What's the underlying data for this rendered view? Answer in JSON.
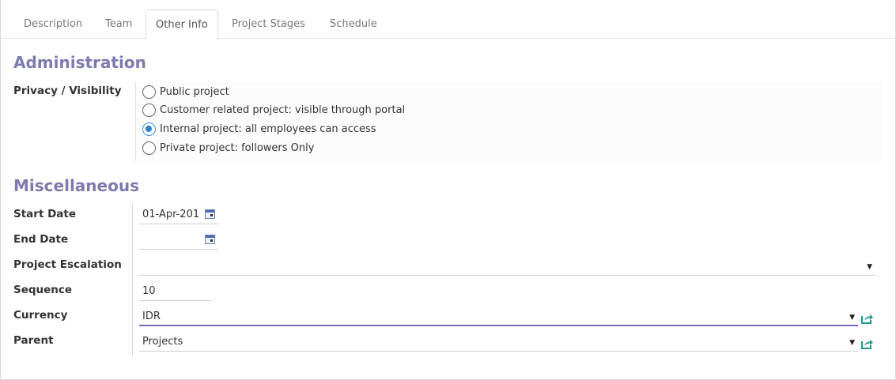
{
  "tabs": [
    {
      "label": "Description",
      "active": false
    },
    {
      "label": "Team",
      "active": false
    },
    {
      "label": "Other Info",
      "active": true
    },
    {
      "label": "Project Stages",
      "active": false
    },
    {
      "label": "Schedule",
      "active": false
    }
  ],
  "administration": {
    "title": "Administration",
    "privacy_label": "Privacy / Visibility",
    "options": [
      {
        "label": "Public project",
        "checked": false
      },
      {
        "label": "Customer related project: visible through portal",
        "checked": false
      },
      {
        "label": "Internal project: all employees can access",
        "checked": true
      },
      {
        "label": "Private project: followers Only",
        "checked": false
      }
    ]
  },
  "misc": {
    "title": "Miscellaneous",
    "start_date": {
      "label": "Start Date",
      "value": "01-Apr-201"
    },
    "end_date": {
      "label": "End Date",
      "value": ""
    },
    "escalation": {
      "label": "Project Escalation",
      "value": ""
    },
    "sequence": {
      "label": "Sequence",
      "value": "10"
    },
    "currency": {
      "label": "Currency",
      "value": "IDR"
    },
    "parent": {
      "label": "Parent",
      "value": "Projects"
    }
  },
  "colors": {
    "section_title": "#7c7bad",
    "radio_checked": "#2a7fd4",
    "focus_underline": "#7c65c4",
    "external_link_icon": "#1a9c8c"
  }
}
